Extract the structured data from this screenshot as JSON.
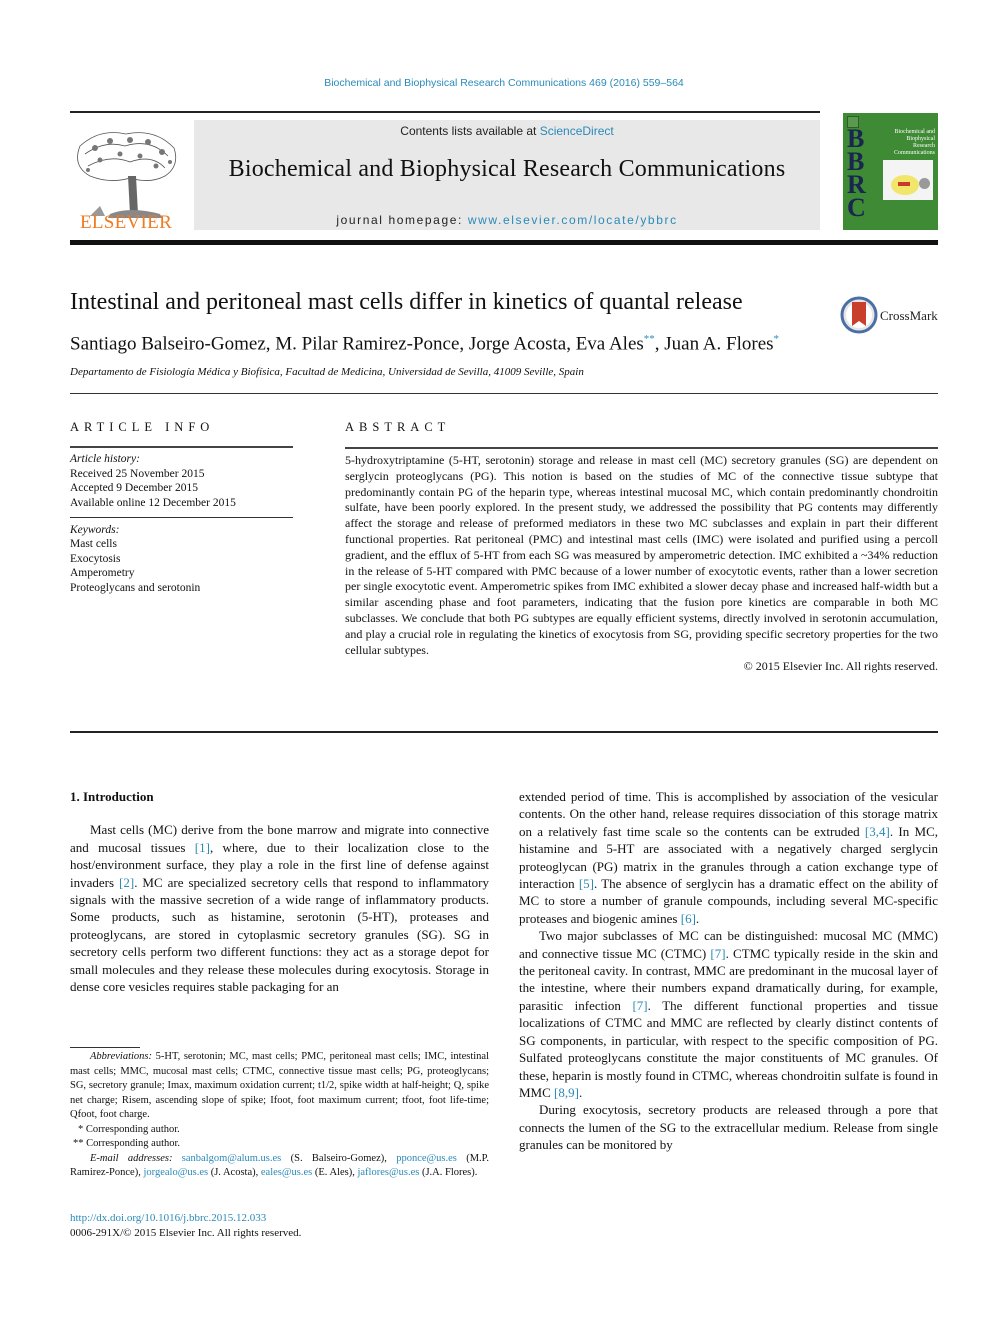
{
  "header": {
    "running_head": "Biochemical and Biophysical Research Communications 469 (2016) 559–564",
    "contents_prefix": "Contents lists available at ",
    "contents_link": "ScienceDirect",
    "journal_name": "Biochemical and Biophysical Research Communications",
    "homepage_prefix": "journal homepage: ",
    "homepage_link": "www.elsevier.com/locate/ybbrc",
    "publisher_logo_text": "ELSEVIER",
    "cover": {
      "letters": [
        "B",
        "B",
        "R",
        "C"
      ],
      "title_lines": [
        "Biochemical and",
        "Biophysical",
        "Research",
        "Communications"
      ]
    },
    "colors": {
      "link": "#2a8ab8",
      "elsevier_orange": "#f07a21",
      "cover_green": "#3f8a35"
    }
  },
  "article": {
    "title": "Intestinal and peritoneal mast cells differ in kinetics of quantal release",
    "crossmark_label": "CrossMark",
    "authors": [
      {
        "name": "Santiago Balseiro-Gomez",
        "sep": ", "
      },
      {
        "name": "M. Pilar Ramirez-Ponce",
        "sep": ", "
      },
      {
        "name": "Jorge Acosta",
        "sep": ", "
      },
      {
        "name": "Eva Ales",
        "mark": "**",
        "sep": ", "
      },
      {
        "name": "Juan A. Flores",
        "mark": "*",
        "sep": ""
      }
    ],
    "affiliation": "Departamento de Fisiología Médica y Biofísica, Facultad de Medicina, Universidad de Sevilla, 41009 Seville, Spain"
  },
  "article_info": {
    "heading": "ARTICLE INFO",
    "history_label": "Article history:",
    "history": [
      "Received 25 November 2015",
      "Accepted 9 December 2015",
      "Available online 12 December 2015"
    ],
    "keywords_label": "Keywords:",
    "keywords": [
      "Mast cells",
      "Exocytosis",
      "Amperometry",
      "Proteoglycans and serotonin"
    ]
  },
  "abstract": {
    "heading": "ABSTRACT",
    "text": "5-hydroxytriptamine (5-HT, serotonin) storage and release in mast cell (MC) secretory granules (SG) are dependent on serglycin proteoglycans (PG). This notion is based on the studies of MC of the connective tissue subtype that predominantly contain PG of the heparin type, whereas intestinal mucosal MC, which contain predominantly chondroitin sulfate, have been poorly explored. In the present study, we addressed the possibility that PG contents may differently affect the storage and release of preformed mediators in these two MC subclasses and explain in part their different functional properties. Rat peritoneal (PMC) and intestinal mast cells (IMC) were isolated and purified using a percoll gradient, and the efflux of 5-HT from each SG was measured by amperometric detection. IMC exhibited a ~34% reduction in the release of 5-HT compared with PMC because of a lower number of exocytotic events, rather than a lower secretion per single exocytotic event. Amperometric spikes from IMC exhibited a slower decay phase and increased half-width but a similar ascending phase and foot parameters, indicating that the fusion pore kinetics are comparable in both MC subclasses. We conclude that both PG subtypes are equally efficient systems, directly involved in serotonin accumulation, and play a crucial role in regulating the kinetics of exocytosis from SG, providing specific secretory properties for the two cellular subtypes.",
    "copyright": "© 2015 Elsevier Inc. All rights reserved."
  },
  "introduction": {
    "heading": "1.  Introduction",
    "left_p1": [
      {
        "t": "Mast cells (MC) derive from the bone marrow and migrate into connective and mucosal tissues "
      },
      {
        "ref": "[1]"
      },
      {
        "t": ", where, due to their localization close to the host/environment surface, they play a role in the first line of defense against invaders "
      },
      {
        "ref": "[2]"
      },
      {
        "t": ". MC are specialized secretory cells that respond to inflammatory signals with the massive secretion of a wide range of inflammatory products. Some products, such as histamine, serotonin (5-HT), proteases and proteoglycans, are stored in cytoplasmic secretory granules (SG). SG in secretory cells perform two different functions: they act as a storage depot for small molecules and they release these molecules during exocytosis. Storage in dense core vesicles requires stable packaging for an"
      }
    ],
    "right_p1": [
      {
        "t": "extended period of time. This is accomplished by association of the vesicular contents. On the other hand, release requires dissociation of this storage matrix on a relatively fast time scale so the contents can be extruded "
      },
      {
        "ref": "[3,4]"
      },
      {
        "t": ". In MC, histamine and 5-HT are associated with a negatively charged serglycin proteoglycan (PG) matrix in the granules through a cation exchange type of interaction "
      },
      {
        "ref": "[5]"
      },
      {
        "t": ". The absence of serglycin has a dramatic effect on the ability of MC to store a number of granule compounds, including several MC-specific proteases and biogenic amines "
      },
      {
        "ref": "[6]"
      },
      {
        "t": "."
      }
    ],
    "right_p2": [
      {
        "t": "Two major subclasses of MC can be distinguished: mucosal MC (MMC) and connective tissue MC (CTMC) "
      },
      {
        "ref": "[7]"
      },
      {
        "t": ". CTMC typically reside in the skin and the peritoneal cavity. In contrast, MMC are predominant in the mucosal layer of the intestine, where their numbers expand dramatically during, for example, parasitic infection "
      },
      {
        "ref": "[7]"
      },
      {
        "t": ". The different functional properties and tissue localizations of CTMC and MMC are reflected by clearly distinct contents of SG components, in particular, with respect to the specific composition of PG. Sulfated proteoglycans constitute the major constituents of MC granules. Of these, heparin is mostly found in CTMC, whereas chondroitin sulfate is found in MMC "
      },
      {
        "ref": "[8,9]"
      },
      {
        "t": "."
      }
    ],
    "right_p3": [
      {
        "t": "During exocytosis, secretory products are released through a pore that connects the lumen of the SG to the extracellular medium. Release from single granules can be monitored by"
      }
    ]
  },
  "footnotes": {
    "abbrev_label": "Abbreviations:",
    "abbrev_text": " 5-HT, serotonin; MC, mast cells; PMC, peritoneal mast cells; IMC, intestinal mast cells; MMC, mucosal mast cells; CTMC, connective tissue mast cells; PG, proteoglycans; SG, secretory granule; Imax, maximum oxidation current; t1/2, spike width at half-height; Q, spike net charge; Risem, ascending slope of spike; Ifoot, foot maximum current; tfoot, foot life-time; Qfoot, foot charge.",
    "corr1": "* Corresponding author.",
    "corr2": "** Corresponding author.",
    "email_label": "E-mail addresses:",
    "emails": [
      {
        "email": "sanbalgom@alum.us.es",
        "who": " (S. Balseiro-Gomez), "
      },
      {
        "email": "pponce@us.es",
        "who": " (M.P. Ramirez-Ponce), "
      },
      {
        "email": "jorgealo@us.es",
        "who": " (J. Acosta), "
      },
      {
        "email": "eales@us.es",
        "who": " (E. Ales), "
      },
      {
        "email": "jaflores@us.es",
        "who": " (J.A. Flores)."
      }
    ],
    "doi": "http://dx.doi.org/10.1016/j.bbrc.2015.12.033",
    "issn_line": "0006-291X/© 2015 Elsevier Inc. All rights reserved."
  }
}
